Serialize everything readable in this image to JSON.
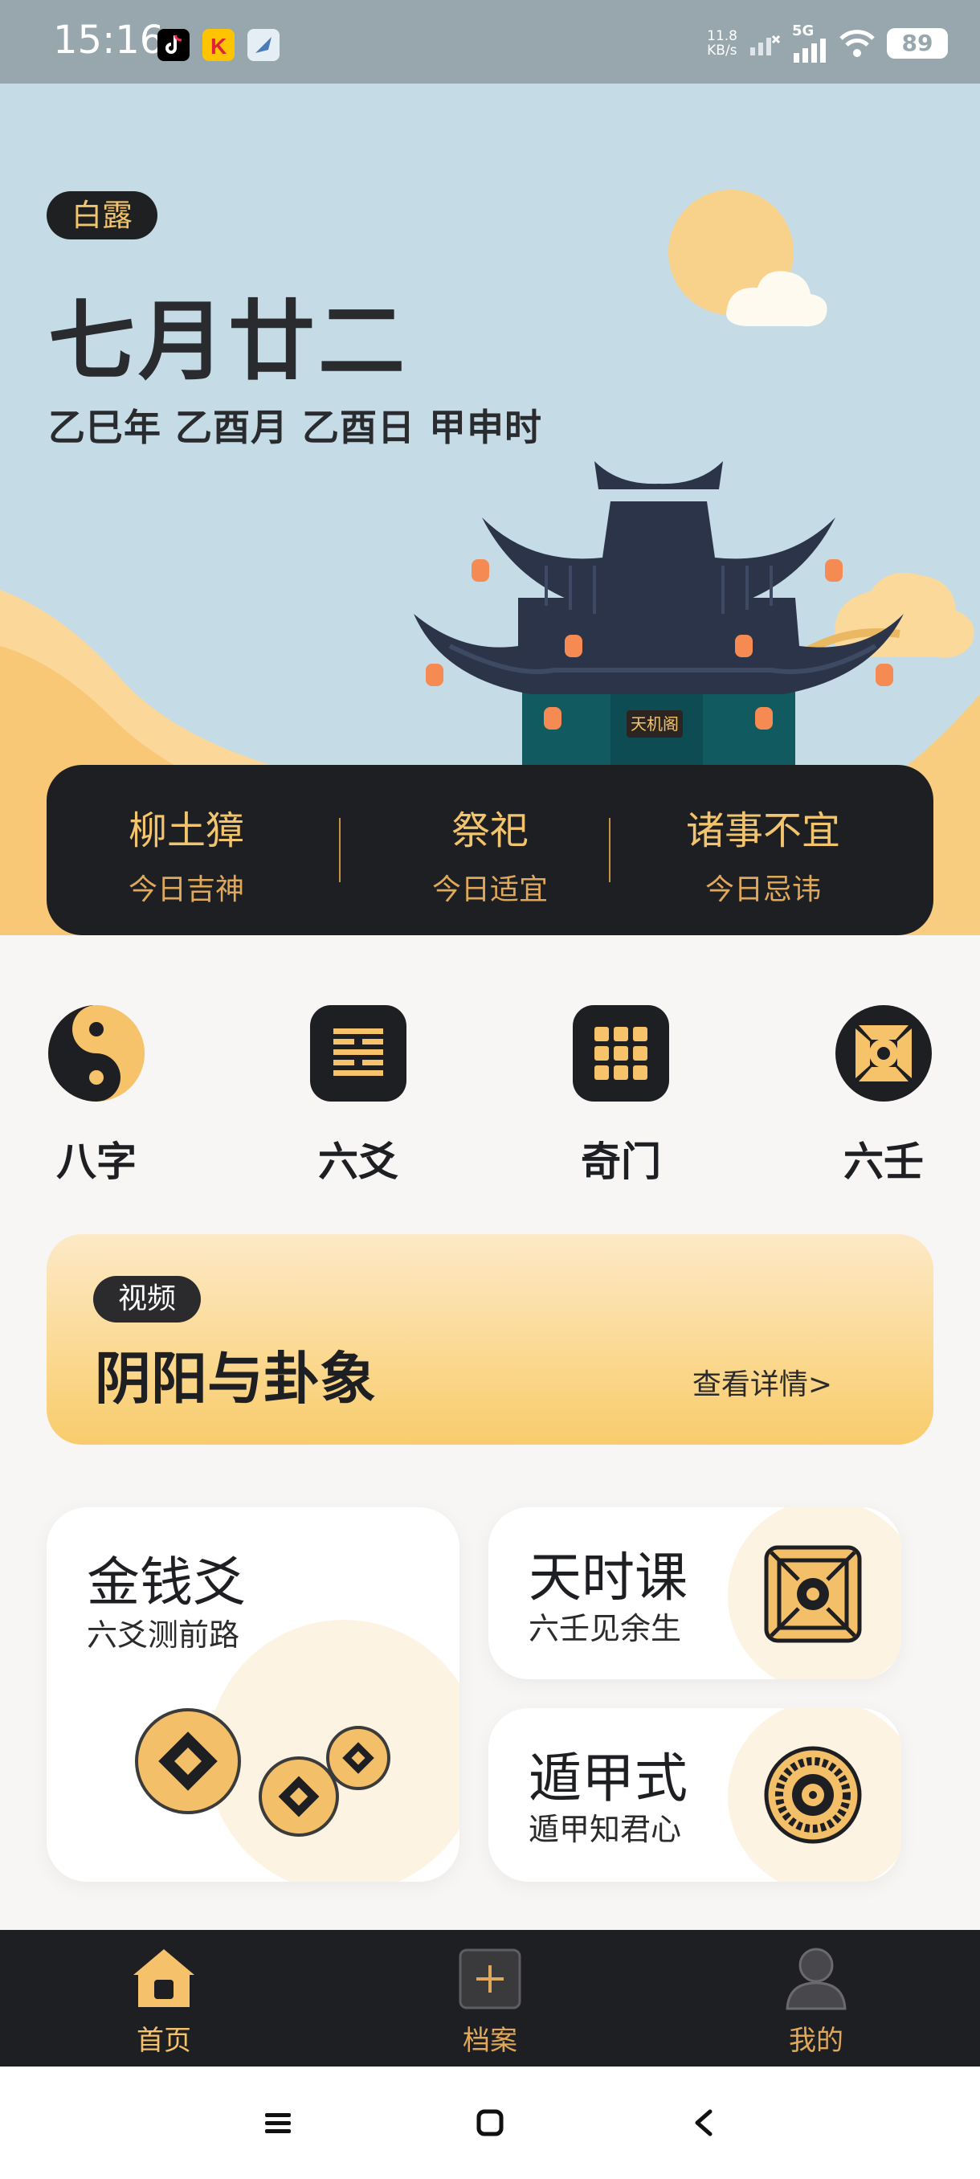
{
  "status_bar": {
    "time": "15:16",
    "net_speed_value": "11.8",
    "net_speed_unit": "KB/s",
    "network": "5G",
    "battery": "89",
    "app_icons": [
      "tiktok-icon",
      "k-app-icon",
      "feather-app-icon"
    ]
  },
  "hero": {
    "solar_term": "白露",
    "lunar_date": "七月廿二",
    "ganzhi": "乙巳年 乙酉月 乙酉日 甲申时",
    "temple_plaque": "天机阁"
  },
  "almanac": [
    {
      "value": "柳土獐",
      "label": "今日吉神"
    },
    {
      "value": "祭祀",
      "label": "今日适宜"
    },
    {
      "value": "诸事不宜",
      "label": "今日忌讳"
    }
  ],
  "features": [
    {
      "label": "八字",
      "icon": "yin-yang-icon"
    },
    {
      "label": "六爻",
      "icon": "hexagram-icon"
    },
    {
      "label": "奇门",
      "icon": "grid-nine-icon"
    },
    {
      "label": "六壬",
      "icon": "compass-disc-icon"
    }
  ],
  "video_banner": {
    "tag": "视频",
    "title": "阴阳与卦象",
    "link": "查看详情>"
  },
  "cards": {
    "coin": {
      "title": "金钱爻",
      "subtitle": "六爻测前路"
    },
    "tianshi": {
      "title": "天时课",
      "subtitle": "六壬见余生"
    },
    "dunjia": {
      "title": "遁甲式",
      "subtitle": "遁甲知君心"
    }
  },
  "bottom_nav": [
    {
      "label": "首页",
      "icon": "home-icon",
      "active": true
    },
    {
      "label": "档案",
      "icon": "plus-square-icon",
      "active": false
    },
    {
      "label": "我的",
      "icon": "user-icon",
      "active": false
    }
  ],
  "colors": {
    "accent_gold": "#f2c46d",
    "dark": "#1e1f22",
    "sky": "#c5dce7",
    "active_nav": "#f5c26b",
    "inactive_nav": "#e0a85a"
  }
}
